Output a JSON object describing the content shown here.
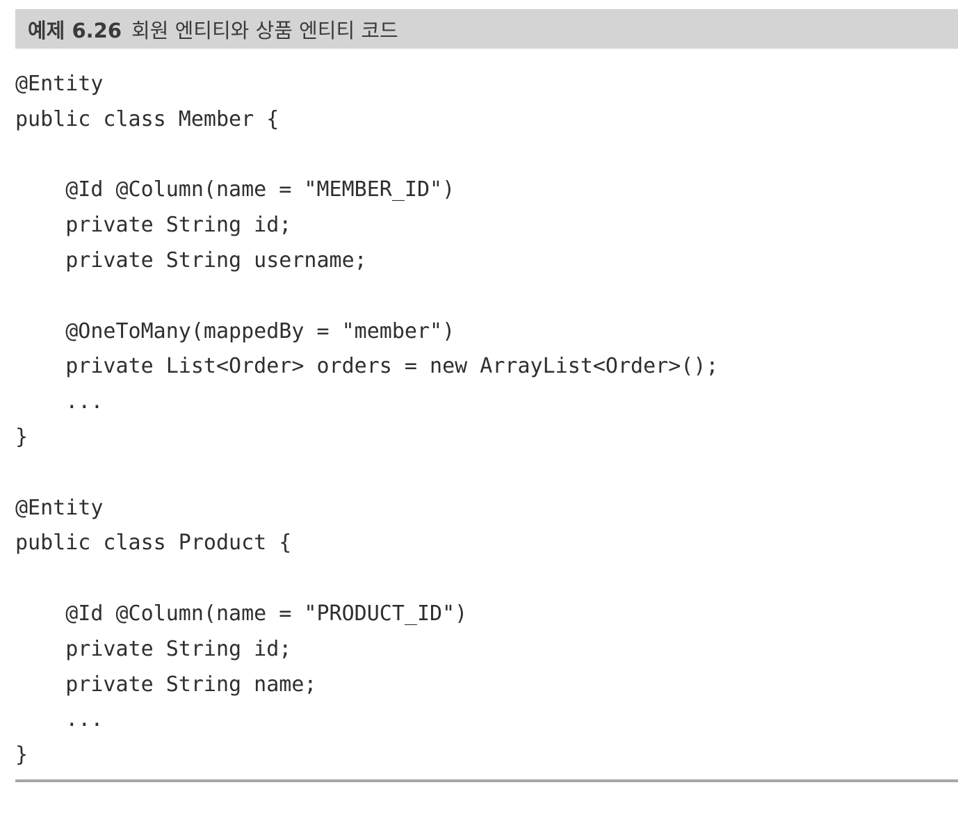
{
  "caption": {
    "number": "예제 6.26",
    "title": "회원 엔티티와 상품 엔티티 코드"
  },
  "code_lines": [
    "@Entity",
    "public class Member {",
    "",
    "    @Id @Column(name = \"MEMBER_ID\")",
    "    private String id;",
    "    private String username;",
    "",
    "    @OneToMany(mappedBy = \"member\")",
    "    private List<Order> orders = new ArrayList<Order>();",
    "    ...",
    "}",
    "",
    "@Entity",
    "public class Product {",
    "",
    "    @Id @Column(name = \"PRODUCT_ID\")",
    "    private String id;",
    "    private String name;",
    "    ...",
    "}"
  ]
}
